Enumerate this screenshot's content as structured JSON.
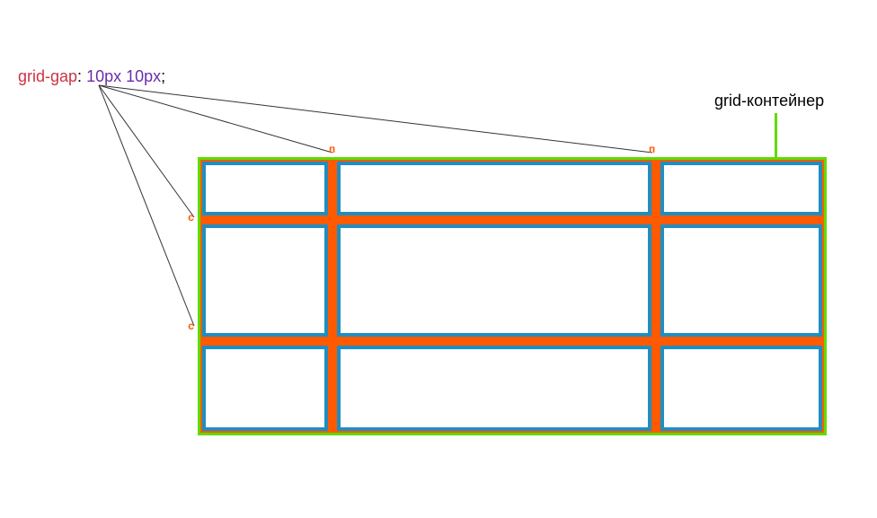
{
  "prop": {
    "name": "grid-gap",
    "value": "10px 10px",
    "colon": ": ",
    "semicolon": ";"
  },
  "rightLabel": "grid-контейнер",
  "grid": {
    "columns": [
      "140px",
      "1fr",
      "180px"
    ],
    "rows": [
      "60px",
      "1fr",
      "95px"
    ],
    "gap": "10px 10px",
    "cellCount": 9
  },
  "gapMarkers": {
    "col1": "п",
    "col2": "п",
    "row1": "с",
    "row2": "с"
  }
}
